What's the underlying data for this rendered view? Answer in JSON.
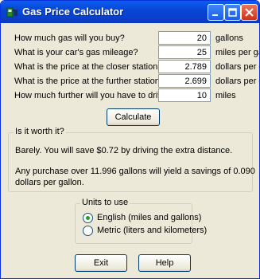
{
  "window": {
    "title": "Gas Price Calculator"
  },
  "titlebar_buttons": {
    "minimize": "minimize-icon",
    "maximize": "maximize-icon",
    "close": "close-icon"
  },
  "form": {
    "rows": [
      {
        "label": "How much gas will you buy?",
        "value": "20",
        "unit": "gallons"
      },
      {
        "label": "What is your car's gas mileage?",
        "value": "25",
        "unit": "miles per gallon"
      },
      {
        "label": "What is the price at the closer station?",
        "value": "2.789",
        "unit": "dollars per gallon"
      },
      {
        "label": "What is the price at the further station?",
        "value": "2.699",
        "unit": "dollars per gallon"
      },
      {
        "label": "How much further will you have to drive?",
        "value": "10",
        "unit": "miles"
      }
    ],
    "calculate_label": "Calculate"
  },
  "result": {
    "legend": "Is it worth it?",
    "line1": "Barely.  You will save $0.72 by driving the extra distance.",
    "line2": "Any purchase over 11.996 gallons will yield a savings of 0.090",
    "line3": "dollars per gallon."
  },
  "units": {
    "legend": "Units to use",
    "options": [
      {
        "label": "English (miles and gallons)",
        "selected": true
      },
      {
        "label": "Metric (liters and kilometers)",
        "selected": false
      }
    ]
  },
  "footer": {
    "exit_label": "Exit",
    "help_label": "Help"
  }
}
